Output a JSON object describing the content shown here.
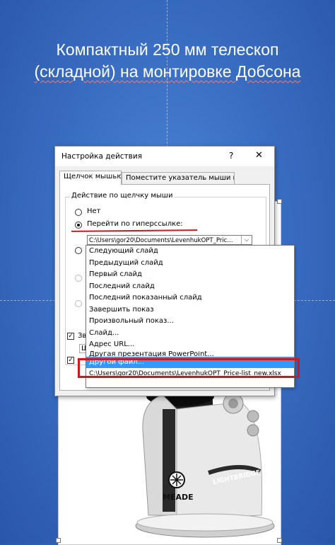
{
  "slide": {
    "title_line1": "Компактный  250 мм телескоп",
    "title_line2": "(складной) на монтировке Добсона"
  },
  "dialog": {
    "title": "Настройка действия",
    "help_label": "?",
    "close_label": "✕",
    "tabs": [
      {
        "label": "Щелчок мышью",
        "active": true
      },
      {
        "label": "Поместите указатель мыши на",
        "active": false
      }
    ],
    "group_label": "Действие по щелчку мыши",
    "options": [
      {
        "label": "Нет",
        "selected": false
      },
      {
        "label": "Перейти по гиперссылке:",
        "selected": true
      }
    ],
    "hyperlink_value": "C:\\Users\\gor20\\Documents\\LevenhukOPT_Pric...",
    "combo_arrow": "⌵",
    "partial_checkbox_label": "Зв",
    "partial_field_text": "Щ",
    "checkbox_mark": "✓"
  },
  "dropdown": {
    "items": [
      "Следующий слайд",
      "Предыдущий слайд",
      "Первый слайд",
      "Последний слайд",
      "Последний показанный слайд",
      "Завершить показ",
      "Произвольный показ...",
      "Слайд...",
      "Адрес URL...",
      "Другая презентация PowerPoint...",
      "Другой файл...",
      "C:\\Users\\gor20\\Documents\\LevenhukOPT_Price-list_new.xlsx"
    ],
    "selected_index": 10
  },
  "telescope": {
    "brand": "MEADE",
    "model": "LIGHTBRIDGE"
  },
  "colors": {
    "background": "#3a6fc4",
    "highlight": "#d7141a",
    "selection": "#3399ff"
  }
}
